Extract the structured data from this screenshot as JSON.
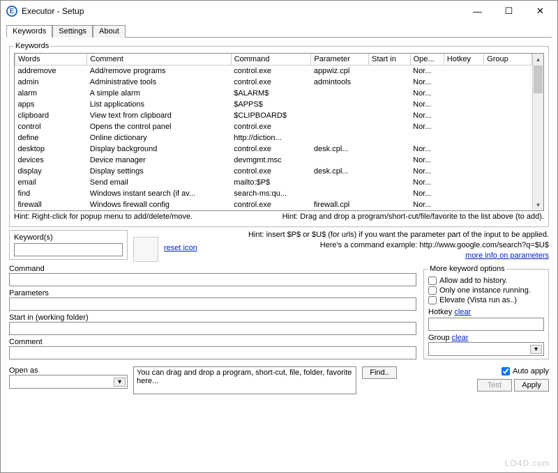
{
  "window": {
    "icon_letter": "E",
    "title": "Executor - Setup"
  },
  "tabs": [
    "Keywords",
    "Settings",
    "About"
  ],
  "groupbox_label": "Keywords",
  "columns": [
    "Words",
    "Comment",
    "Command",
    "Parameter",
    "Start in",
    "Ope...",
    "Hotkey",
    "Group"
  ],
  "rows": [
    {
      "words": "addremove",
      "comment": "Add/remove programs",
      "command": "control.exe",
      "parameter": "appwiz.cpl",
      "start": "",
      "open": "Nor...",
      "hotkey": "",
      "group": ""
    },
    {
      "words": "admin",
      "comment": "Administrative tools",
      "command": "control.exe",
      "parameter": "admintools",
      "start": "",
      "open": "Nor...",
      "hotkey": "",
      "group": ""
    },
    {
      "words": "alarm",
      "comment": "A simple alarm",
      "command": "$ALARM$",
      "parameter": "",
      "start": "",
      "open": "Nor...",
      "hotkey": "",
      "group": ""
    },
    {
      "words": "apps",
      "comment": "List applications",
      "command": "$APPS$",
      "parameter": "",
      "start": "",
      "open": "Nor...",
      "hotkey": "",
      "group": ""
    },
    {
      "words": "clipboard",
      "comment": "View text from clipboard",
      "command": "$CLIPBOARD$",
      "parameter": "",
      "start": "",
      "open": "Nor...",
      "hotkey": "",
      "group": ""
    },
    {
      "words": "control",
      "comment": "Opens the control panel",
      "command": "control.exe",
      "parameter": "",
      "start": "",
      "open": "Nor...",
      "hotkey": "",
      "group": ""
    },
    {
      "words": "define",
      "comment": "Online dictionary",
      "command": "http://diction...",
      "parameter": "",
      "start": "",
      "open": "",
      "hotkey": "",
      "group": ""
    },
    {
      "words": "desktop",
      "comment": "Display background",
      "command": "control.exe",
      "parameter": "desk.cpl...",
      "start": "",
      "open": "Nor...",
      "hotkey": "",
      "group": ""
    },
    {
      "words": "devices",
      "comment": "Device manager",
      "command": "devmgmt.msc",
      "parameter": "",
      "start": "",
      "open": "Nor...",
      "hotkey": "",
      "group": ""
    },
    {
      "words": "display",
      "comment": "Display settings",
      "command": "control.exe",
      "parameter": "desk.cpl...",
      "start": "",
      "open": "Nor...",
      "hotkey": "",
      "group": ""
    },
    {
      "words": "email",
      "comment": "Send email",
      "command": "mailto:$P$",
      "parameter": "",
      "start": "",
      "open": "Nor...",
      "hotkey": "",
      "group": ""
    },
    {
      "words": "find",
      "comment": "Windows instant search (if av...",
      "command": "search-ms:qu...",
      "parameter": "",
      "start": "",
      "open": "Nor...",
      "hotkey": "",
      "group": ""
    },
    {
      "words": "firewall",
      "comment": "Windows firewall config",
      "command": "control.exe",
      "parameter": "firewall.cpl",
      "start": "",
      "open": "Nor...",
      "hotkey": "",
      "group": ""
    }
  ],
  "hints": {
    "left": "Hint: Right-click for popup menu to add/delete/move.",
    "right": "Hint: Drag and drop a program/short-cut/file/favorite to the list above (to add)."
  },
  "form": {
    "keyword_label": "Keyword(s)",
    "reset_icon": "reset icon",
    "hint1": "Hint: insert $P$ or $U$ (for urls) if you want the parameter part of the input to be applied.",
    "hint2": "Here's a command example: http://www.google.com/search?q=$U$",
    "more_info": "more info on parameters",
    "command_label": "Command",
    "parameters_label": "Parameters",
    "startin_label": "Start in (working folder)",
    "comment_label": "Comment",
    "openas_label": "Open as",
    "dragbox": "You can drag and drop a program, short-cut, file, folder, favorite here...",
    "find_btn": "Find..",
    "test_btn": "Test",
    "apply_btn": "Apply"
  },
  "more": {
    "legend": "More keyword options",
    "allow_history": "Allow add to history.",
    "one_instance": "Only one instance running.",
    "elevate": "Elevate (Vista run as..)",
    "hotkey_label": "Hotkey",
    "clear": "clear",
    "group_label": "Group",
    "auto_apply": "Auto apply"
  },
  "watermark": "LO4D.com"
}
